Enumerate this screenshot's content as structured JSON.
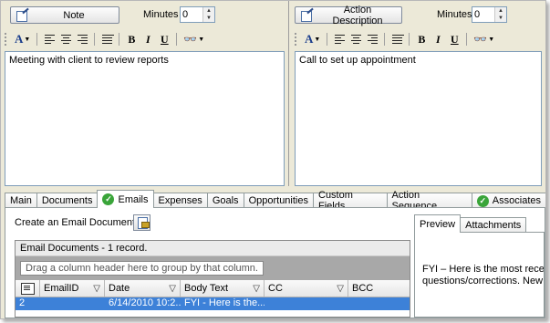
{
  "note_pane": {
    "button_label": "Note",
    "minutes_label": "Minutes",
    "minutes_value": "0",
    "text": "Meeting with client to review reports"
  },
  "action_pane": {
    "button_label": "Action Description",
    "minutes_label": "Minutes",
    "minutes_value": "0",
    "text": "Call to set up appointment"
  },
  "toolbar": {
    "font_color_glyph": "A",
    "bold_glyph": "B",
    "italic_glyph": "I",
    "underline_glyph": "U",
    "find_glyph": "🔭"
  },
  "tabs": [
    {
      "label": "Main"
    },
    {
      "label": "Documents"
    },
    {
      "label": "Emails",
      "active": true,
      "check": true
    },
    {
      "label": "Expenses"
    },
    {
      "label": "Goals"
    },
    {
      "label": "Opportunities"
    },
    {
      "label": "Custom Fields"
    },
    {
      "label": "Action Sequence"
    },
    {
      "label": "Associates",
      "check": true
    }
  ],
  "emails": {
    "create_label": "Create an Email Document",
    "grid_title": "Email Documents - 1 record.",
    "group_hint": "Drag a column header here to group by that column.",
    "columns": [
      "EmailID",
      "Date",
      "Body Text",
      "CC",
      "BCC"
    ],
    "row": [
      "2",
      "6/14/2010  10:2...",
      "FYI - Here is the...",
      "",
      ""
    ]
  },
  "preview": {
    "tabs": [
      "Preview",
      "Attachments"
    ],
    "line1": "FYI – Here is the most recent r",
    "line2": "questions/corrections. New c"
  },
  "colors": {
    "selection": "#3d81d8",
    "check_green": "#3aa53a"
  }
}
